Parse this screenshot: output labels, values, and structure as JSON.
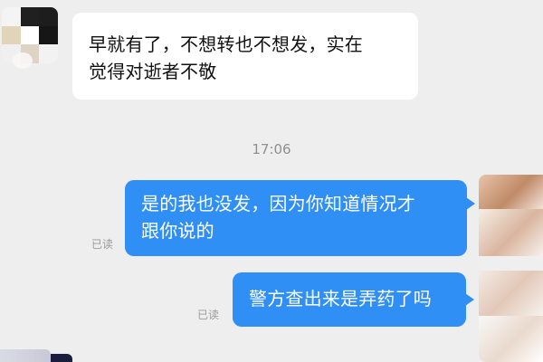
{
  "messages": {
    "incoming": {
      "line_1": "早就有了，不想转也不想发，实在",
      "line_2": "觉得对逝者不敬"
    },
    "time_divider": "17:06",
    "outgoing": [
      {
        "lines": [
          "是的我也没发，因为你知道情况才",
          "跟你说的"
        ],
        "status": "已读"
      },
      {
        "lines": [
          "警方查出来是弄药了吗"
        ],
        "status": "已读"
      }
    ]
  },
  "colors": {
    "chat_background": "#eeeeee",
    "incoming_bubble": "#ffffff",
    "outgoing_bubble": "#2f8ff5",
    "time_text": "#8f8f8f",
    "status_text": "#9a9a9a"
  },
  "icons": {
    "incoming_avatar": "pixelated-avatar",
    "outgoing_avatar": "blurred-avatar",
    "bottom_avatar": "cropped-avatar"
  }
}
